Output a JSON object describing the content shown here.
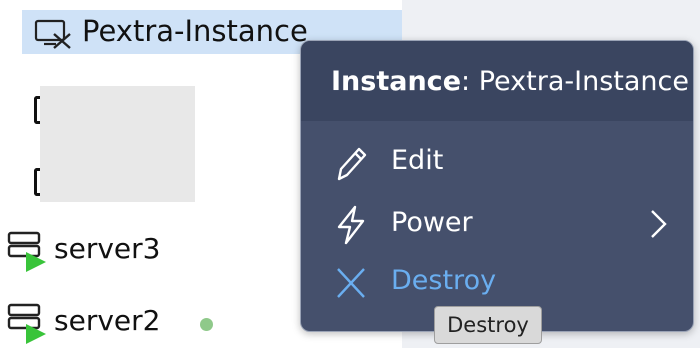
{
  "tree": {
    "selected_item": {
      "label": "Pextra-Instance",
      "icon": "vm-stopped-icon"
    },
    "servers": [
      {
        "label": "server3",
        "icon": "server-running-icon"
      },
      {
        "label": "server2",
        "icon": "server-running-icon",
        "status_color": "#8fc98a"
      }
    ]
  },
  "context_menu": {
    "header_prefix": "Instance",
    "header_separator": ":",
    "header_name": "Pextra-Instance",
    "items": [
      {
        "label": "Edit",
        "icon": "pencil-icon"
      },
      {
        "label": "Power",
        "icon": "lightning-icon",
        "has_submenu": true
      },
      {
        "label": "Destroy",
        "icon": "close-icon",
        "color": "#6aaef0"
      }
    ]
  },
  "tooltip": {
    "text": "Destroy"
  },
  "colors": {
    "menu_bg": "#45506c",
    "menu_header_bg": "#3a4560",
    "selection": "#cfe2f7",
    "accent": "#6aaef0",
    "running": "#39c43a"
  }
}
